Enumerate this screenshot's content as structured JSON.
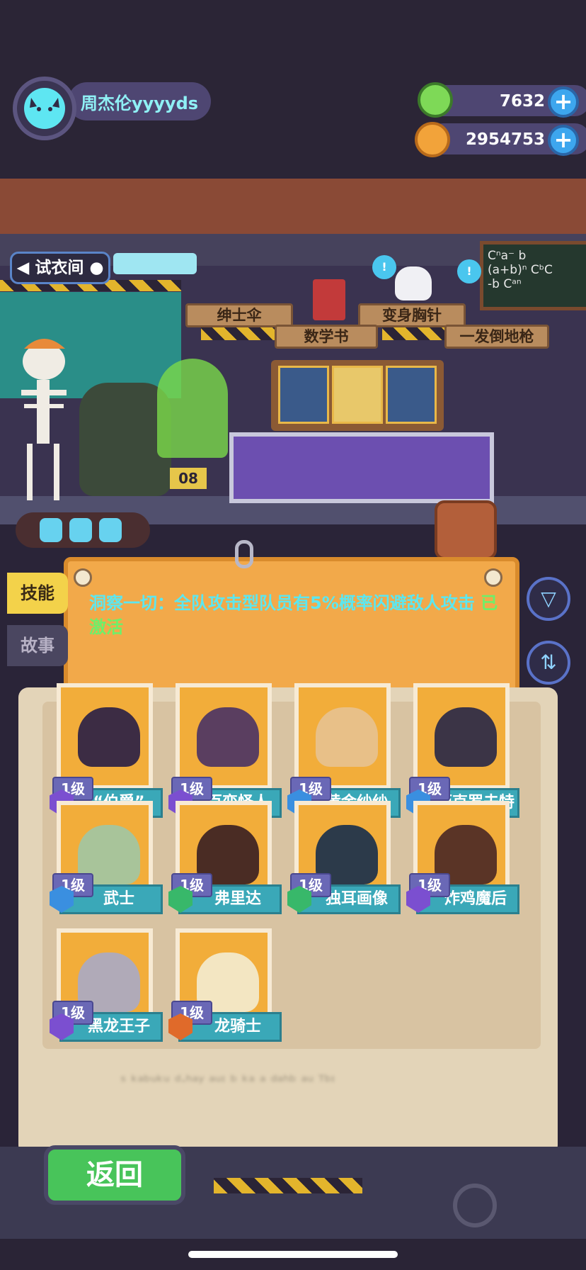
{
  "player": {
    "name": "周杰伦yyyyds"
  },
  "resources": [
    {
      "name": "gem",
      "value": "7632",
      "color": "#7ed957"
    },
    {
      "name": "coin",
      "value": "2954753",
      "color": "#f2a33a"
    }
  ],
  "fitting_room": {
    "label": "试衣间"
  },
  "lab_items": {
    "umbrella": "绅士伞",
    "brooch": "变身胸针",
    "math_book": "数学书",
    "gun": "一发倒地枪"
  },
  "chalkboard": {
    "line1": "Cⁿa⁻ b",
    "line2": "(a+b)ⁿ  CᵇC",
    "line3": "-b   Cᵃⁿ"
  },
  "desk_tag": "08",
  "tabs": {
    "skill": "技能",
    "story": "故事"
  },
  "skill": {
    "description": "洞察一切：全队攻击型队员有5%概率闪避敌人攻击",
    "status": "已激活"
  },
  "characters": [
    {
      "level": "1级",
      "name": "“伯爵”",
      "badge_color": "#7b4fd0",
      "face": "#3c2c44"
    },
    {
      "level": "1级",
      "name": "百变怪人",
      "badge_color": "#7b4fd0",
      "face": "#5a3e60"
    },
    {
      "level": "1级",
      "name": "黄金纱纱",
      "badge_color": "#3a8fe0",
      "face": "#e8c088"
    },
    {
      "level": "1级",
      "name": "迈克罗夫特",
      "badge_color": "#3a8fe0",
      "face": "#3b3446"
    },
    {
      "level": "1级",
      "name": "武士",
      "badge_color": "#3a8fe0",
      "face": "#a8c49a"
    },
    {
      "level": "1级",
      "name": "弗里达",
      "badge_color": "#38b86a",
      "face": "#4a2c24"
    },
    {
      "level": "1级",
      "name": "独耳画像",
      "badge_color": "#38b86a",
      "face": "#2c3a4a"
    },
    {
      "level": "1级",
      "name": "炸鸡魔后",
      "badge_color": "#7b4fd0",
      "face": "#5a3426"
    },
    {
      "level": "1级",
      "name": "黑龙王子",
      "badge_color": "#7b4fd0",
      "face": "#b0aab8"
    },
    {
      "level": "1级",
      "name": "龙骑士",
      "badge_color": "#e06a2a",
      "face": "#f3e6c2"
    }
  ],
  "footer_blur": "ˢ ᵏᵃᵇᵘᵏᵘ ᵈ·ʰᵃʸ   ᵃᵘᶦ ᵇ ᵏᵃ ᵃ ᵈᵃʰᵇ ᵃᵘ ᵀᵇᶦ",
  "back_button": {
    "label": "返回"
  }
}
